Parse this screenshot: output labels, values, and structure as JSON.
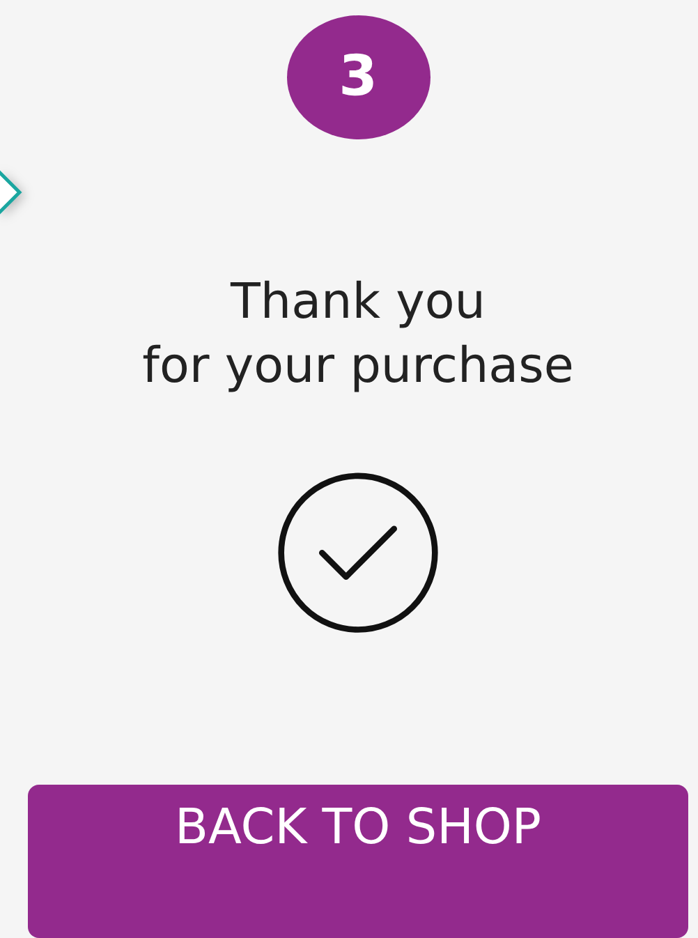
{
  "step": {
    "number": "3"
  },
  "message": {
    "lines": [
      "Thank you",
      "for your purchase"
    ]
  },
  "button": {
    "label": "BACK TO SHOP"
  }
}
